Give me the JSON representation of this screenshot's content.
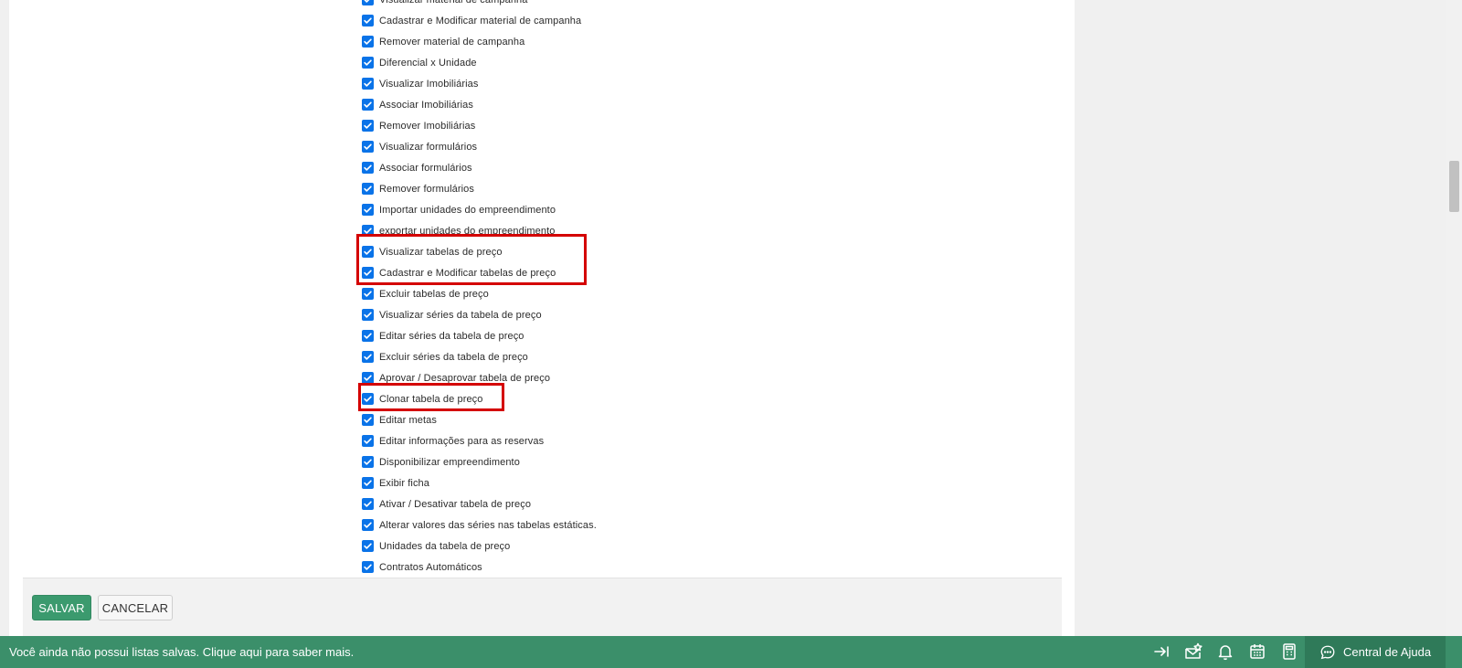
{
  "permissions": [
    "Visualizar material de campanha",
    "Cadastrar e Modificar material de campanha",
    "Remover material de campanha",
    "Diferencial x Unidade",
    "Visualizar Imobiliárias",
    "Associar Imobiliárias",
    "Remover Imobiliárias",
    "Visualizar formulários",
    "Associar formulários",
    "Remover formulários",
    "Importar unidades do empreendimento",
    "exportar unidades do empreendimento",
    "Visualizar tabelas de preço",
    "Cadastrar e Modificar tabelas de preço",
    "Excluir tabelas de preço",
    "Visualizar séries da tabela de preço",
    "Editar séries da tabela de preço",
    "Excluir séries da tabela de preço",
    "Aprovar / Desaprovar tabela de preço",
    "Clonar tabela de preço",
    "Editar metas",
    "Editar informações para as reservas",
    "Disponibilizar empreendimento",
    "Exibir ficha",
    "Ativar / Desativar tabela de preço",
    "Alterar valores das séries nas tabelas estáticas.",
    "Unidades da tabela de preço",
    "Contratos Automáticos"
  ],
  "actions": {
    "save_label": "SALVAR",
    "cancel_label": "CANCELAR"
  },
  "bottom_bar": {
    "message": "Você ainda não possui listas salvas. Clique aqui para saber mais.",
    "help_label": "Central de Ajuda",
    "icons": [
      "collapse-arrow-icon",
      "mail-star-icon",
      "bell-icon",
      "calendar-icon",
      "calculator-icon"
    ]
  },
  "colors": {
    "checkbox": "#0a73e8",
    "highlight": "#d40000",
    "save_button": "#3b9a6e",
    "bottom_bar": "#3b8f6a"
  }
}
